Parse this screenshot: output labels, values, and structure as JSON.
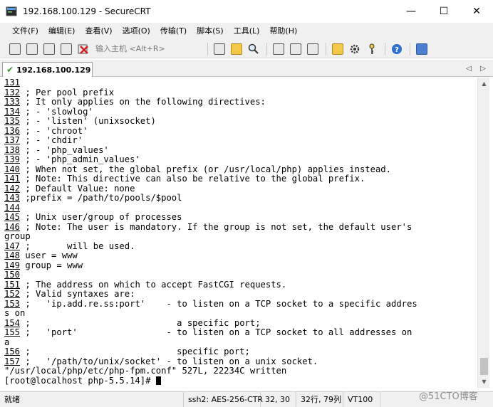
{
  "window": {
    "title": "192.168.100.129 - SecureCRT",
    "minimize": "—",
    "maximize": "☐",
    "close": "✕"
  },
  "menu": [
    "文件(F)",
    "编辑(E)",
    "查看(V)",
    "选项(O)",
    "传输(T)",
    "脚本(S)",
    "工具(L)",
    "帮助(H)"
  ],
  "toolbar": {
    "quick_connect_placeholder": "输入主机 <Alt+R>"
  },
  "tab": {
    "label": "192.168.100.129",
    "check": "✔",
    "prev": "◁",
    "next": "▷"
  },
  "terminal": {
    "lines": [
      {
        "num": "131",
        "text": ""
      },
      {
        "num": "132",
        "text": " ; Per pool prefix"
      },
      {
        "num": "133",
        "text": " ; It only applies on the following directives:"
      },
      {
        "num": "134",
        "text": " ; - 'slowlog'"
      },
      {
        "num": "135",
        "text": " ; - 'listen' (unixsocket)"
      },
      {
        "num": "136",
        "text": " ; - 'chroot'"
      },
      {
        "num": "137",
        "text": " ; - 'chdir'"
      },
      {
        "num": "138",
        "text": " ; - 'php_values'"
      },
      {
        "num": "139",
        "text": " ; - 'php_admin_values'"
      },
      {
        "num": "140",
        "text": " ; When not set, the global prefix (or /usr/local/php) applies instead."
      },
      {
        "num": "141",
        "text": " ; Note: This directive can also be relative to the global prefix."
      },
      {
        "num": "142",
        "text": " ; Default Value: none"
      },
      {
        "num": "143",
        "text": " ;prefix = /path/to/pools/$pool"
      },
      {
        "num": "144",
        "text": ""
      },
      {
        "num": "145",
        "text": " ; Unix user/group of processes"
      },
      {
        "num": "146",
        "text": " ; Note: The user is mandatory. If the group is not set, the default user's"
      },
      {
        "num": "",
        "text": "group"
      },
      {
        "num": "147",
        "text": " ;       will be used."
      },
      {
        "num": "148",
        "text": " user = www"
      },
      {
        "num": "149",
        "text": " group = www"
      },
      {
        "num": "150",
        "text": ""
      },
      {
        "num": "151",
        "text": " ; The address on which to accept FastCGI requests."
      },
      {
        "num": "152",
        "text": " ; Valid syntaxes are:"
      },
      {
        "num": "153",
        "text": " ;   'ip.add.re.ss:port'    - to listen on a TCP socket to a specific addres"
      },
      {
        "num": "",
        "text": "s on"
      },
      {
        "num": "154",
        "text": " ;                            a specific port;"
      },
      {
        "num": "155",
        "text": " ;   'port'                 - to listen on a TCP socket to all addresses on"
      },
      {
        "num": "",
        "text": "a"
      },
      {
        "num": "156",
        "text": " ;                            specific port;"
      },
      {
        "num": "157",
        "text": " ;   '/path/to/unix/socket' - to listen on a unix socket."
      }
    ],
    "written_msg": "\"/usr/local/php/etc/php-fpm.conf\" 527L, 22234C written",
    "prompt": "[root@localhost php-5.5.14]# "
  },
  "status": {
    "ready": "就绪",
    "cipher": "ssh2: AES-256-CTR",
    "cursor": "32, 30",
    "size": "32行, 79列",
    "term": "VT100",
    "watermark": "@51CTO博客"
  }
}
